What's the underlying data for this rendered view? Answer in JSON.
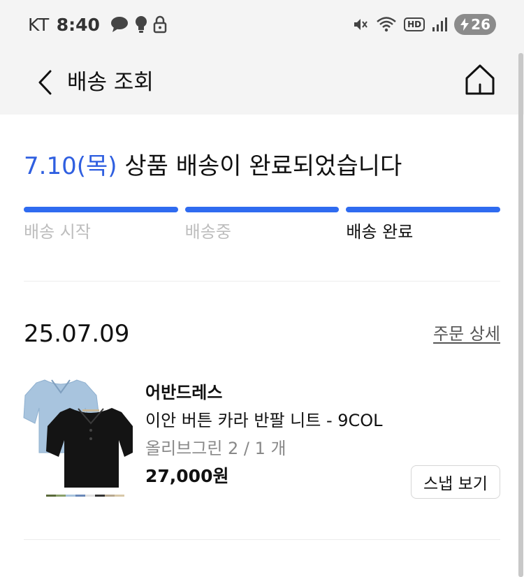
{
  "status_bar": {
    "carrier": "KT",
    "time": "8:40",
    "battery": "26",
    "hd_label": "HD",
    "icons_left": [
      "chat-bubble-icon",
      "lightbulb-icon",
      "lock-icon"
    ],
    "icons_right": [
      "mute-icon",
      "wifi-icon",
      "hd-icon",
      "signal-icon",
      "battery-icon"
    ]
  },
  "header": {
    "title": "배송 조회",
    "back_icon": "chevron-left-icon",
    "home_icon": "home-icon"
  },
  "delivery": {
    "date_text": "7.10(목)",
    "message": " 상품 배송이 완료되었습니다",
    "accent_color": "#2f5fe0",
    "steps": [
      {
        "label": "배송 시작",
        "active": false
      },
      {
        "label": "배송중",
        "active": false
      },
      {
        "label": "배송 완료",
        "active": true
      }
    ]
  },
  "order": {
    "date": "25.07.09",
    "detail_link": "주문 상세",
    "product": {
      "brand": "어반드레스",
      "name": "이안 버튼 카라 반팔 니트 - 9COL",
      "option": "올리브그린 2 / 1 개",
      "price": "27,000원",
      "thumbnail": "knit-polo-shirts-image"
    },
    "snap_button": "스냅 보기"
  }
}
